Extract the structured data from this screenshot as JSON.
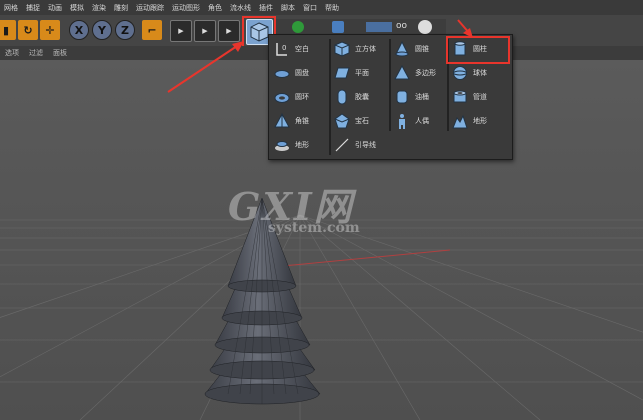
{
  "menu": [
    "网格",
    "捕捉",
    "动画",
    "模拟",
    "渲染",
    "雕刻",
    "运动跟踪",
    "运动图形",
    "角色",
    "流水线",
    "插件",
    "脚本",
    "窗口",
    "帮助"
  ],
  "subbar": [
    "选项",
    "过滤",
    "面板"
  ],
  "toolbar": {
    "axis_x": "X",
    "axis_y": "Y",
    "axis_z": "Z"
  },
  "palette": {
    "col1": [
      {
        "label": "空白",
        "icon": "null-object-icon"
      },
      {
        "label": "圆盘",
        "icon": "disc-icon"
      },
      {
        "label": "圆环",
        "icon": "torus-icon"
      },
      {
        "label": "角锥",
        "icon": "pyramid-icon"
      },
      {
        "label": "地形",
        "icon": "landscape-icon"
      }
    ],
    "col2": [
      {
        "label": "立方体",
        "icon": "cube-icon"
      },
      {
        "label": "平面",
        "icon": "plane-icon"
      },
      {
        "label": "胶囊",
        "icon": "capsule-icon"
      },
      {
        "label": "宝石",
        "icon": "gem-icon"
      },
      {
        "label": "引导线",
        "icon": "guide-line-icon"
      }
    ],
    "col3": [
      {
        "label": "圆锥",
        "icon": "cone-icon"
      },
      {
        "label": "多边形",
        "icon": "polygon-icon"
      },
      {
        "label": "油桶",
        "icon": "oil-tank-icon"
      },
      {
        "label": "人偶",
        "icon": "figure-icon"
      }
    ],
    "col4": [
      {
        "label": "圆柱",
        "icon": "cylinder-icon"
      },
      {
        "label": "球体",
        "icon": "sphere-icon"
      },
      {
        "label": "管道",
        "icon": "tube-icon"
      },
      {
        "label": "地形",
        "icon": "relief-icon"
      }
    ]
  },
  "watermark": {
    "big": "GXI网",
    "small": "system.com"
  },
  "colors": {
    "highlight": "#e8352c",
    "accent_blue": "#7ba2cf",
    "orange": "#d88a1a"
  }
}
